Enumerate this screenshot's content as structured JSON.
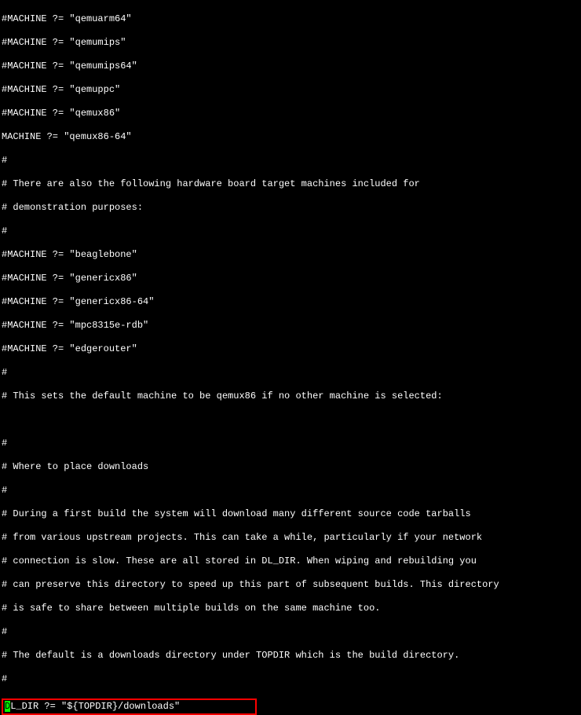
{
  "lines": {
    "l1": "#MACHINE ?= \"qemuarm64\"",
    "l2": "#MACHINE ?= \"qemumips\"",
    "l3": "#MACHINE ?= \"qemumips64\"",
    "l4": "#MACHINE ?= \"qemuppc\"",
    "l5": "#MACHINE ?= \"qemux86\"",
    "l6": "MACHINE ?= \"qemux86-64\"",
    "l7": "#",
    "l8": "# There are also the following hardware board target machines included for",
    "l9": "# demonstration purposes:",
    "l10": "#",
    "l11": "#MACHINE ?= \"beaglebone\"",
    "l12": "#MACHINE ?= \"genericx86\"",
    "l13": "#MACHINE ?= \"genericx86-64\"",
    "l14": "#MACHINE ?= \"mpc8315e-rdb\"",
    "l15": "#MACHINE ?= \"edgerouter\"",
    "l16": "#",
    "l17": "# This sets the default machine to be qemux86 if no other machine is selected:",
    "l18": "",
    "l19": "",
    "l20": "#",
    "l21": "# Where to place downloads",
    "l22": "#",
    "l23": "# During a first build the system will download many different source code tarballs",
    "l24": "# from various upstream projects. This can take a while, particularly if your network",
    "l25": "# connection is slow. These are all stored in DL_DIR. When wiping and rebuilding you",
    "l26": "# can preserve this directory to speed up this part of subsequent builds. This directory",
    "l27": "# is safe to share between multiple builds on the same machine too.",
    "l28": "#",
    "l29": "# The default is a downloads directory under TOPDIR which is the build directory.",
    "l30": "#"
  },
  "highlighted": {
    "cursor_char": "D",
    "rest": "L_DIR ?= \"${TOPDIR}/downloads\""
  }
}
